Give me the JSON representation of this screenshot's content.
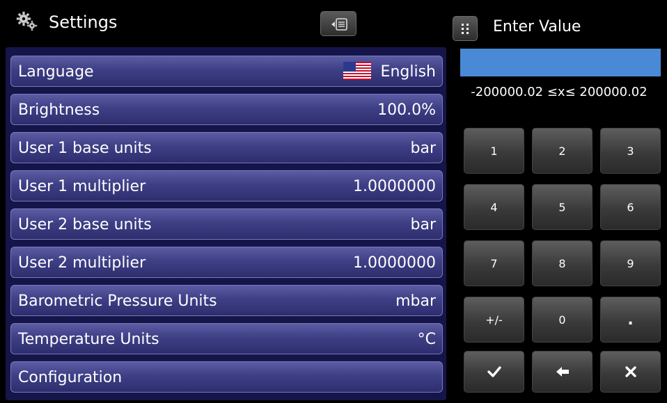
{
  "header": {
    "title": "Settings",
    "gear_icon": "gear-icon",
    "back_icon": "back-to-list-icon"
  },
  "settings": [
    {
      "label": "Language",
      "value": "English",
      "icon": "us-flag-icon"
    },
    {
      "label": "Brightness",
      "value": "100.0%"
    },
    {
      "label": "User 1 base units",
      "value": "bar"
    },
    {
      "label": "User 1 multiplier",
      "value": "1.0000000"
    },
    {
      "label": "User 2 base units",
      "value": "bar"
    },
    {
      "label": "User 2 multiplier",
      "value": "1.0000000"
    },
    {
      "label": "Barometric Pressure Units",
      "value": "mbar"
    },
    {
      "label": "Temperature Units",
      "value": "°C"
    },
    {
      "label": "Configuration",
      "value": ""
    }
  ],
  "keypad": {
    "title": "Enter Value",
    "grid_icon": "keypad-grid-icon",
    "entry_value": "",
    "range": "-200000.02 ≤x≤ 200000.02",
    "keys": [
      "1",
      "2",
      "3",
      "4",
      "5",
      "6",
      "7",
      "8",
      "9",
      "+/-",
      "0",
      "."
    ],
    "action_icons": [
      "check-icon",
      "backspace-arrow-icon",
      "close-icon"
    ]
  },
  "colors": {
    "list_panel": "#15154a",
    "row_gradient_top": "#5c5ca4",
    "row_gradient_bottom": "#2d2d6e",
    "entry_field": "#4a89d6",
    "key_top": "#5e5e5e",
    "key_bottom": "#2a2a2a"
  }
}
